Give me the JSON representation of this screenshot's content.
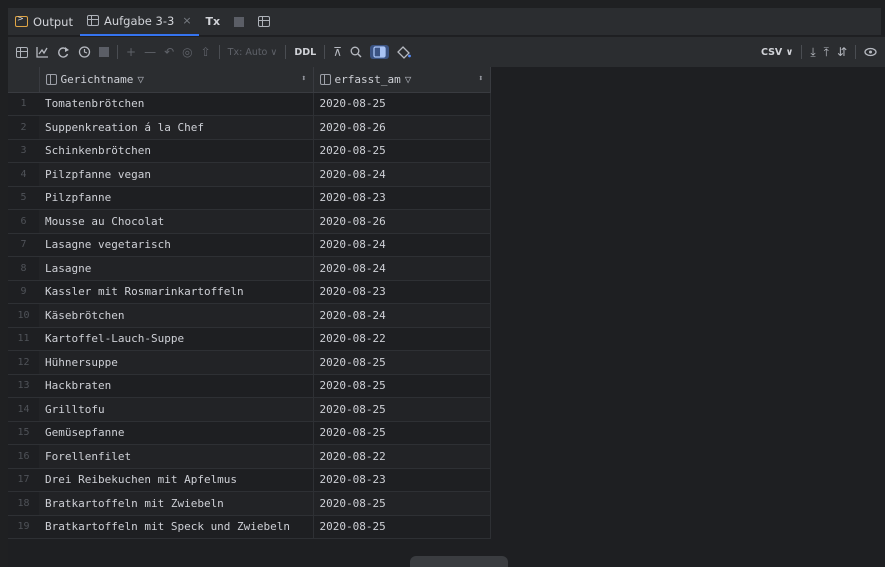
{
  "tabs": [
    {
      "label": "Output",
      "icon": "output-icon"
    },
    {
      "label": "Aufgabe 3-3",
      "icon": "table-icon",
      "active": true,
      "close": "×"
    },
    {
      "label": "Tx",
      "icon": "tx-icon"
    }
  ],
  "toolbar": {
    "tx_mode": "Tx: Auto",
    "ddl": "DDL",
    "export_format": "CSV",
    "chevron": "∨"
  },
  "grid": {
    "columns": [
      {
        "name": "Gerichtname"
      },
      {
        "name": "erfasst_am"
      }
    ],
    "rows": [
      {
        "num": "1",
        "name": "Tomatenbrötchen",
        "date": "2020-08-25"
      },
      {
        "num": "2",
        "name": "Suppenkreation á la Chef",
        "date": "2020-08-26"
      },
      {
        "num": "3",
        "name": "Schinkenbrötchen",
        "date": "2020-08-25"
      },
      {
        "num": "4",
        "name": "Pilzpfanne vegan",
        "date": "2020-08-24"
      },
      {
        "num": "5",
        "name": "Pilzpfanne",
        "date": "2020-08-23"
      },
      {
        "num": "6",
        "name": "Mousse au Chocolat",
        "date": "2020-08-26"
      },
      {
        "num": "7",
        "name": "Lasagne vegetarisch",
        "date": "2020-08-24"
      },
      {
        "num": "8",
        "name": "Lasagne",
        "date": "2020-08-24"
      },
      {
        "num": "9",
        "name": "Kassler mit Rosmarinkartoffeln",
        "date": "2020-08-23"
      },
      {
        "num": "10",
        "name": "Käsebrötchen",
        "date": "2020-08-24"
      },
      {
        "num": "11",
        "name": "Kartoffel-Lauch-Suppe",
        "date": "2020-08-22"
      },
      {
        "num": "12",
        "name": "Hühnersuppe",
        "date": "2020-08-25"
      },
      {
        "num": "13",
        "name": "Hackbraten",
        "date": "2020-08-25"
      },
      {
        "num": "14",
        "name": "Grilltofu",
        "date": "2020-08-25"
      },
      {
        "num": "15",
        "name": "Gemüsepfanne",
        "date": "2020-08-25"
      },
      {
        "num": "16",
        "name": "Forellenfilet",
        "date": "2020-08-22"
      },
      {
        "num": "17",
        "name": "Drei Reibekuchen mit Apfelmus",
        "date": "2020-08-23"
      },
      {
        "num": "18",
        "name": "Bratkartoffeln mit Zwiebeln",
        "date": "2020-08-25"
      },
      {
        "num": "19",
        "name": "Bratkartoffeln mit Speck und Zwiebeln",
        "date": "2020-08-25"
      }
    ]
  }
}
